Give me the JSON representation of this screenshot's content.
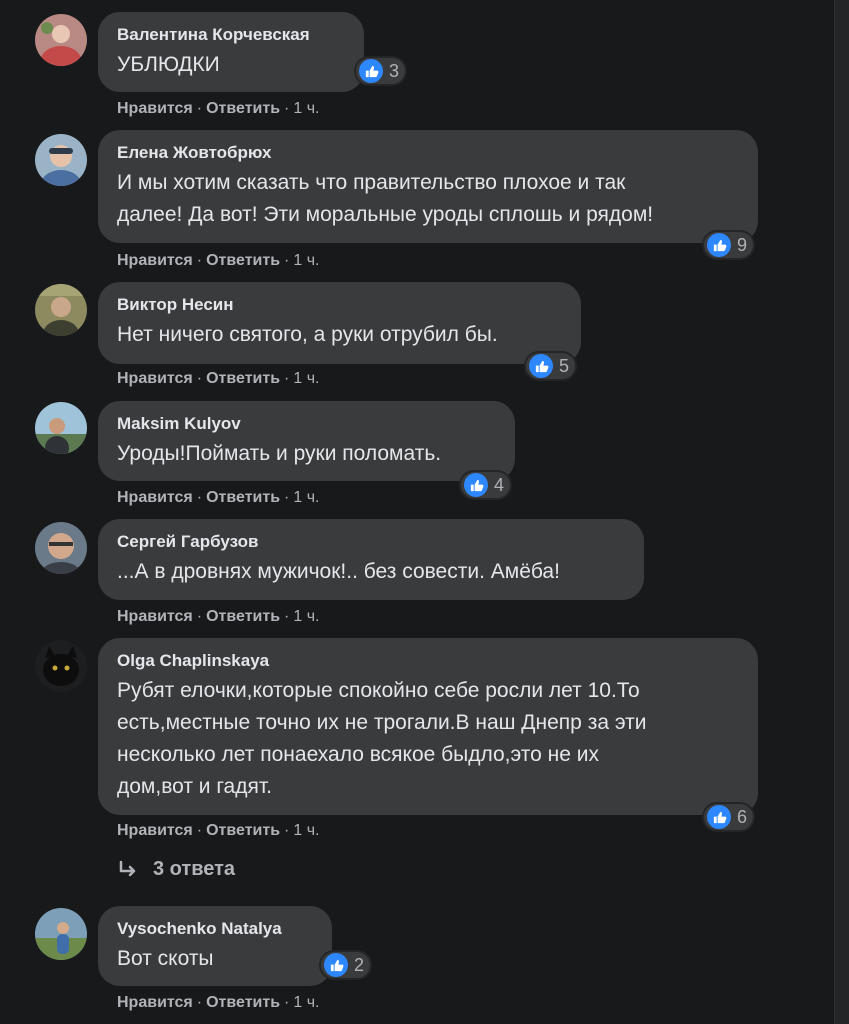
{
  "comments": [
    {
      "author": "Валентина Корчевская",
      "text": [
        "УБЛЮДКИ"
      ],
      "likes": "3",
      "like_label": "Нравится",
      "reply_label": "Ответить",
      "time": "1 ч."
    },
    {
      "author": "Елена Жовтобрюх",
      "text": [
        "И мы хотим сказать что правительство плохое и так",
        "далее! Да вот! Эти моральные уроды сплошь и рядом!"
      ],
      "likes": "9",
      "like_label": "Нравится",
      "reply_label": "Ответить",
      "time": "1 ч."
    },
    {
      "author": "Виктор Несин",
      "text": [
        "Нет ничего святого, а руки отрубил бы."
      ],
      "likes": "5",
      "like_label": "Нравится",
      "reply_label": "Ответить",
      "time": "1 ч."
    },
    {
      "author": "Maksim Kulyov",
      "text": [
        "Уроды!Поймать и руки поломать."
      ],
      "likes": "4",
      "like_label": "Нравится",
      "reply_label": "Ответить",
      "time": "1 ч."
    },
    {
      "author": "Сергей Гарбузов",
      "text": [
        "...А в дровнях мужичок!.. без совести. Амёба!"
      ],
      "like_label": "Нравится",
      "reply_label": "Ответить",
      "time": "1 ч."
    },
    {
      "author": "Olga Chaplinskaya",
      "text": [
        "Рубят елочки,которые спокойно себе росли лет 10.То",
        "есть,местные точно их не трогали.В наш Днепр за эти",
        "несколько лет понаехало всякое быдло,это не их",
        "дом,вот и гадят."
      ],
      "likes": "6",
      "like_label": "Нравится",
      "reply_label": "Ответить",
      "time": "1 ч."
    },
    {
      "author": "Vysochenko Natalya",
      "text": [
        "Вот скоты"
      ],
      "likes": "2",
      "like_label": "Нравится",
      "reply_label": "Ответить",
      "time": "1 ч."
    }
  ],
  "replies_label": "3 ответа",
  "colors": {
    "background": "#18191a",
    "bubble": "#3a3b3c",
    "like_blue": "#2d88ff",
    "secondary_text": "#b0b3b8"
  }
}
